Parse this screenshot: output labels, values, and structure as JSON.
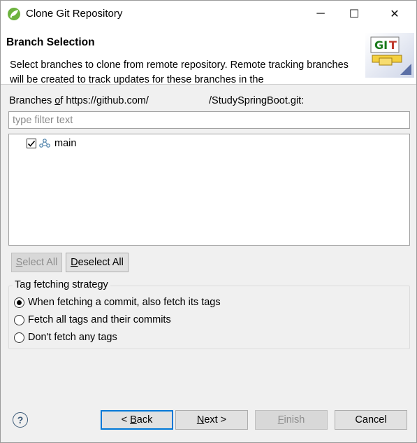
{
  "window": {
    "title": "Clone Git Repository",
    "controls": {
      "minimize": "─",
      "maximize": "☐",
      "close": "✕"
    }
  },
  "header": {
    "title": "Branch Selection",
    "description": "Select branches to clone from remote repository. Remote tracking branches will be created to track updates for these branches in the",
    "icon_text": "GIT"
  },
  "branches": {
    "label_prefix": "Branches ",
    "label_mnemonic": "o",
    "label_rest": "f https://github.com/",
    "url_suffix": "/StudySpringBoot.git:",
    "filter_placeholder": "type filter text",
    "items": [
      {
        "name": "main",
        "checked": true
      }
    ]
  },
  "buttons": {
    "select_all_mnemonic": "S",
    "select_all_rest": "elect All",
    "deselect_all_mnemonic": "D",
    "deselect_all_rest": "eselect All"
  },
  "tag_strategy": {
    "title": "Tag fetching strategy",
    "options": [
      {
        "label": "When fetching a commit, also fetch its tags",
        "selected": true
      },
      {
        "label": "Fetch all tags and their commits",
        "selected": false
      },
      {
        "label": "Don't fetch any tags",
        "selected": false
      }
    ]
  },
  "footer": {
    "help": "?",
    "back_pre": "< ",
    "back_mnemonic": "B",
    "back_rest": "ack",
    "next_mnemonic": "N",
    "next_rest": "ext >",
    "finish_mnemonic": "F",
    "finish_rest": "inish",
    "cancel": "Cancel"
  },
  "colors": {
    "accent": "#0078d7",
    "dialog_bg": "#f0f0f0",
    "git_green": "#1a7a1a",
    "git_red": "#c0392b"
  }
}
